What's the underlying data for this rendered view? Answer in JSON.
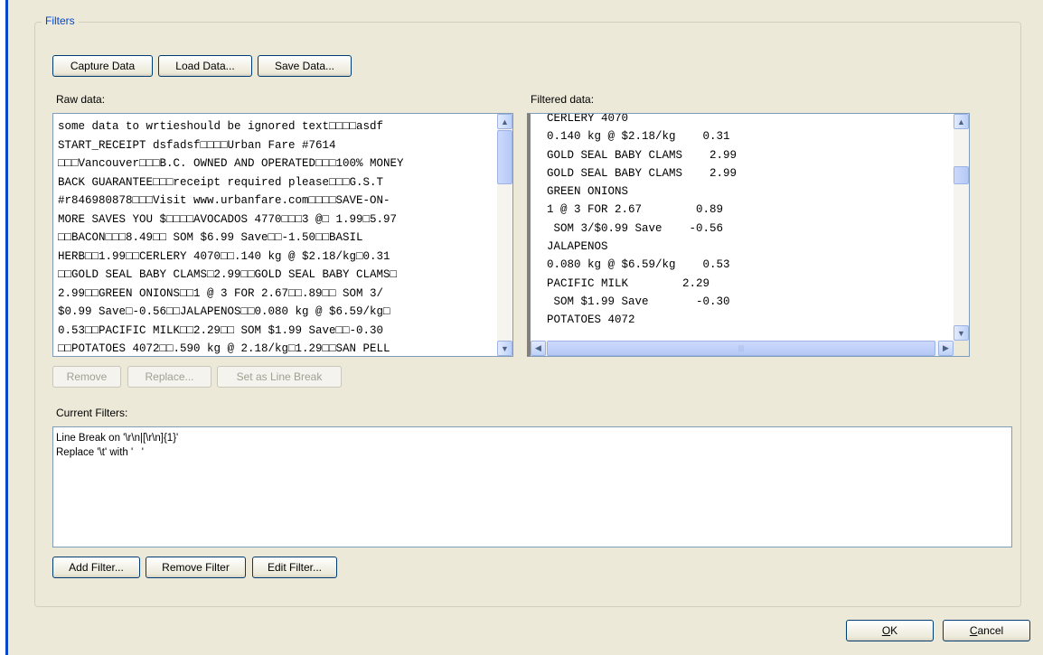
{
  "group": {
    "title": "Filters"
  },
  "toolbar": {
    "capture": "Capture Data",
    "load": "Load Data...",
    "save": "Save Data..."
  },
  "raw": {
    "label": "Raw data:",
    "lines": [
      "some data to wrtieshould be ignored text□□□□asdf",
      "START_RECEIPT dsfadsf□□□□Urban Fare #7614",
      "□□□Vancouver□□□B.C. OWNED AND OPERATED□□□100% MONEY",
      "BACK GUARANTEE□□□receipt required please□□□G.S.T",
      "#r846980878□□□Visit www.urbanfare.com□□□□SAVE-ON-",
      "MORE SAVES YOU $□□□□AVOCADOS 4770□□□3 @□ 1.99□5.97",
      "□□BACON□□□8.49□□ SOM $6.99 Save□□-1.50□□BASIL",
      "HERB□□1.99□□CERLERY 4070□□.140 kg @ $2.18/kg□0.31",
      "□□GOLD SEAL BABY CLAMS□2.99□□GOLD SEAL BABY CLAMS□",
      "2.99□□GREEN ONIONS□□1 @ 3 FOR 2.67□□.89□□ SOM 3/",
      "$0.99 Save□-0.56□□JALAPENOS□□0.080 kg @ $6.59/kg□",
      "0.53□□PACIFIC MILK□□2.29□□ SOM $1.99 Save□□-0.30",
      "□□POTATOES 4072□□.590 kg @ 2.18/kg□1.29□□SAN PELL"
    ]
  },
  "filtered": {
    "label": "Filtered data:",
    "lines": [
      "CERLERY 4070",
      "0.140 kg @ $2.18/kg    0.31",
      "GOLD SEAL BABY CLAMS    2.99",
      "GOLD SEAL BABY CLAMS    2.99",
      "GREEN ONIONS",
      "1 @ 3 FOR 2.67        0.89",
      " SOM 3/$0.99 Save    -0.56",
      "JALAPENOS",
      "0.080 kg @ $6.59/kg    0.53",
      "PACIFIC MILK        2.29",
      " SOM $1.99 Save       -0.30",
      "POTATOES 4072"
    ]
  },
  "raw_actions": {
    "remove": "Remove",
    "replace": "Replace...",
    "line_break": "Set as Line Break"
  },
  "current_filters": {
    "label": "Current Filters:",
    "items": [
      "Line Break on '\\r\\n|[\\r\\n]{1}'",
      "Replace '\\t' with '   '"
    ]
  },
  "filter_actions": {
    "add": "Add Filter...",
    "remove": "Remove Filter",
    "edit": "Edit Filter..."
  },
  "dialog": {
    "ok_key": "O",
    "ok_rest": "K",
    "cancel_key": "C",
    "cancel_rest": "ancel"
  },
  "icons": {
    "scroll_up": "▲",
    "scroll_down": "▼",
    "scroll_left": "◀",
    "scroll_right": "▶"
  }
}
